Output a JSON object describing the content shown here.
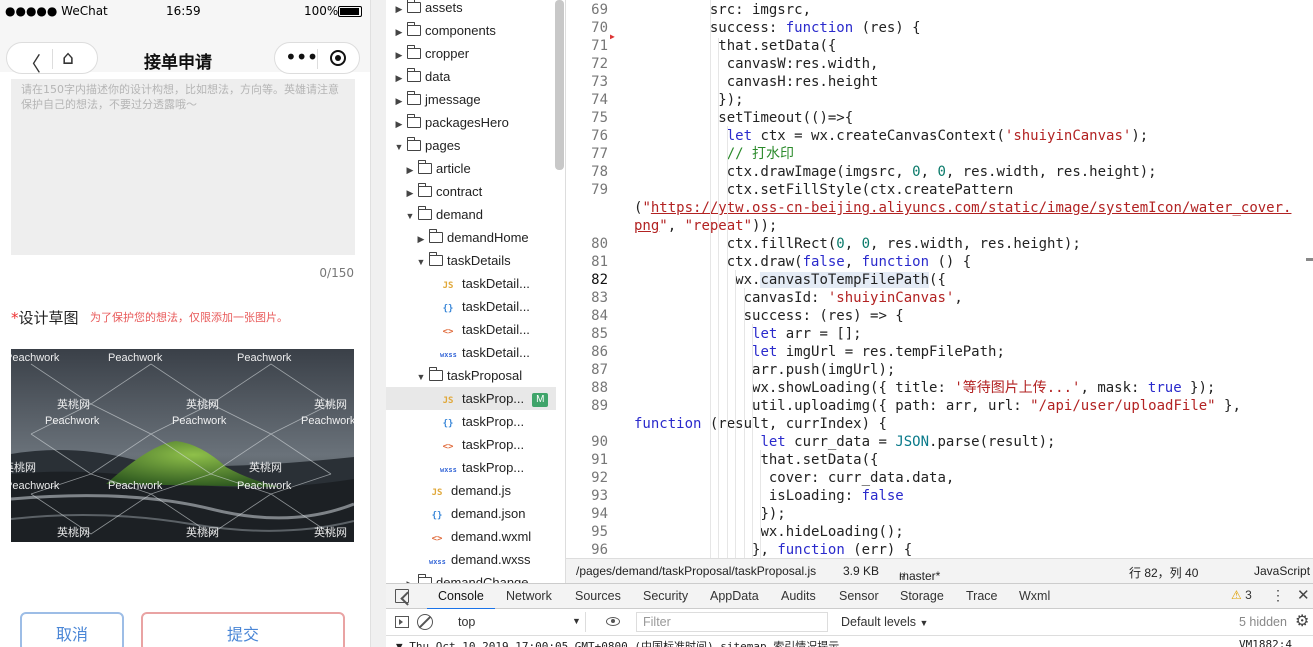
{
  "phone": {
    "status": {
      "carrier": "●●●●● WeChat",
      "time": "16:59",
      "battery": "100%"
    },
    "nav": {
      "title": "接单申请"
    },
    "description": {
      "placeholder": "请在150字内描述你的设计构想，比如想法，方向等。英雄请注意保护自己的想法，不要过分透露哦～",
      "counter": "0/150"
    },
    "sketch": {
      "star": "*",
      "label": "设计草图",
      "hint": "为了保护您的想法，仅限添加一张图片。"
    },
    "watermark": {
      "en": "Peachwork",
      "cn": "英桃网"
    },
    "buttons": {
      "cancel": "取消",
      "submit": "提交"
    }
  },
  "tree": {
    "items": [
      {
        "label": "assets",
        "type": "folder",
        "depth": 0,
        "open": false
      },
      {
        "label": "components",
        "type": "folder",
        "depth": 0,
        "open": false
      },
      {
        "label": "cropper",
        "type": "folder",
        "depth": 0,
        "open": false
      },
      {
        "label": "data",
        "type": "folder",
        "depth": 0,
        "open": false
      },
      {
        "label": "jmessage",
        "type": "folder",
        "depth": 0,
        "open": false
      },
      {
        "label": "packagesHero",
        "type": "folder",
        "depth": 0,
        "open": false
      },
      {
        "label": "pages",
        "type": "folder",
        "depth": 0,
        "open": true
      },
      {
        "label": "article",
        "type": "folder",
        "depth": 1,
        "open": false
      },
      {
        "label": "contract",
        "type": "folder",
        "depth": 1,
        "open": false
      },
      {
        "label": "demand",
        "type": "folder",
        "depth": 1,
        "open": true
      },
      {
        "label": "demandHome",
        "type": "folder",
        "depth": 2,
        "open": false
      },
      {
        "label": "taskDetails",
        "type": "folder",
        "depth": 2,
        "open": true
      },
      {
        "label": "taskDetail...",
        "type": "js",
        "depth": 3
      },
      {
        "label": "taskDetail...",
        "type": "json",
        "depth": 3
      },
      {
        "label": "taskDetail...",
        "type": "wxml",
        "depth": 3
      },
      {
        "label": "taskDetail...",
        "type": "wxss",
        "depth": 3
      },
      {
        "label": "taskProposal",
        "type": "folder",
        "depth": 2,
        "open": true
      },
      {
        "label": "taskProp...",
        "type": "js",
        "depth": 3,
        "selected": true,
        "badge": "M"
      },
      {
        "label": "taskProp...",
        "type": "json",
        "depth": 3
      },
      {
        "label": "taskProp...",
        "type": "wxml",
        "depth": 3
      },
      {
        "label": "taskProp...",
        "type": "wxss",
        "depth": 3
      },
      {
        "label": "demand.js",
        "type": "js",
        "depth": 2
      },
      {
        "label": "demand.json",
        "type": "json",
        "depth": 2
      },
      {
        "label": "demand.wxml",
        "type": "wxml",
        "depth": 2
      },
      {
        "label": "demand.wxss",
        "type": "wxss",
        "depth": 2
      },
      {
        "label": "demandChange",
        "type": "folder",
        "depth": 1,
        "open": false
      }
    ],
    "icons": {
      "js": "JS",
      "json": "{}",
      "wxml": "<>",
      "wxss": "wxss"
    }
  },
  "editor": {
    "lines": [
      {
        "n": "69",
        "indent": 9,
        "html": "src: imgsrc,"
      },
      {
        "n": "70",
        "indent": 9,
        "html": "success: <span class=\"kw\">function</span> (res) {"
      },
      {
        "n": "71",
        "indent": 10,
        "html": "that.setData({"
      },
      {
        "n": "72",
        "indent": 11,
        "html": "canvasW:res.width,"
      },
      {
        "n": "73",
        "indent": 11,
        "html": "canvasH:res.height"
      },
      {
        "n": "74",
        "indent": 10,
        "html": "});"
      },
      {
        "n": "75",
        "indent": 10,
        "html": "setTimeout(()=>{"
      },
      {
        "n": "76",
        "indent": 11,
        "html": "<span class=\"kw\">let</span> ctx = wx.createCanvasContext(<span class=\"str\">'shuiyinCanvas'</span>);"
      },
      {
        "n": "77",
        "indent": 11,
        "html": "<span class=\"cmt\">// 打水印</span>"
      },
      {
        "n": "78",
        "indent": 11,
        "html": "ctx.drawImage(imgsrc, <span class=\"num\">0</span>, <span class=\"num\">0</span>, res.width, res.height);"
      },
      {
        "n": "79",
        "indent": 11,
        "html": "ctx.setFillStyle(ctx.createPattern"
      },
      {
        "n": "",
        "indent": 0,
        "html": "(<span class=\"str\">\"</span><span class=\"url\">https://ytw.oss-cn-beijing.aliyuncs.com/static/image/systemIcon/water_cover.</span>"
      },
      {
        "n": "",
        "indent": 0,
        "html": "<span class=\"url\">png</span><span class=\"str\">\"</span>, <span class=\"str\">\"repeat\"</span>));"
      },
      {
        "n": "80",
        "indent": 11,
        "html": "ctx.fillRect(<span class=\"num\">0</span>, <span class=\"num\">0</span>, res.width, res.height);"
      },
      {
        "n": "81",
        "indent": 11,
        "html": "ctx.draw(<span class=\"kw\">false</span>, <span class=\"kw\">function</span> () {"
      },
      {
        "n": "82",
        "indent": 12,
        "active": true,
        "html": "wx.<span class=\"hl\">canvasToTempFilePath</span>({"
      },
      {
        "n": "83",
        "indent": 13,
        "html": "canvasId: <span class=\"str\">'shuiyinCanvas'</span>,"
      },
      {
        "n": "84",
        "indent": 13,
        "html": "success: (res) => {"
      },
      {
        "n": "85",
        "indent": 14,
        "html": "<span class=\"kw\">let</span> arr = [];"
      },
      {
        "n": "86",
        "indent": 14,
        "html": "<span class=\"kw\">let</span> imgUrl = res.tempFilePath;"
      },
      {
        "n": "87",
        "indent": 14,
        "html": "arr.push(imgUrl);"
      },
      {
        "n": "88",
        "indent": 14,
        "html": "wx.showLoading({ title: <span class=\"str\">'等待图片上传...'</span>, mask: <span class=\"kw\">true</span> });"
      },
      {
        "n": "89",
        "indent": 14,
        "html": "util.uploadimg({ path: arr, url: <span class=\"str\">\"/api/user/uploadFile\"</span> },"
      },
      {
        "n": "",
        "indent": 0,
        "html": "<span class=\"kw\">function</span> (result, currIndex) {"
      },
      {
        "n": "90",
        "indent": 15,
        "html": "<span class=\"kw\">let</span> curr_data = <span class=\"cls\">JSON</span>.parse(result);"
      },
      {
        "n": "91",
        "indent": 15,
        "html": "that.setData({"
      },
      {
        "n": "92",
        "indent": 16,
        "html": "cover: curr_data.data,"
      },
      {
        "n": "93",
        "indent": 16,
        "html": "isLoading: <span class=\"kw\">false</span>"
      },
      {
        "n": "94",
        "indent": 15,
        "html": "});"
      },
      {
        "n": "95",
        "indent": 15,
        "html": "wx.hideLoading();"
      },
      {
        "n": "96",
        "indent": 14,
        "html": "}, <span class=\"kw\">function</span> (err) {"
      }
    ]
  },
  "statusline": {
    "path": "/pages/demand/taskProposal/taskProposal.js",
    "size": "3.9 KB",
    "branch": "master*",
    "position": "行 82，列 40",
    "language": "JavaScript"
  },
  "devtools": {
    "tabs": [
      "Console",
      "Network",
      "Sources",
      "Security",
      "AppData",
      "Audits",
      "Sensor",
      "Storage",
      "Trace",
      "Wxml"
    ],
    "warnings": "3",
    "context": "top",
    "filter_placeholder": "Filter",
    "levels": "Default levels",
    "hidden": "5 hidden",
    "log": {
      "message": "▼ Thu Oct 10 2019 17:00:05 GMT+0800 (中国标准时间) sitemap 索引情况提示",
      "source": "VM1882:4"
    }
  }
}
